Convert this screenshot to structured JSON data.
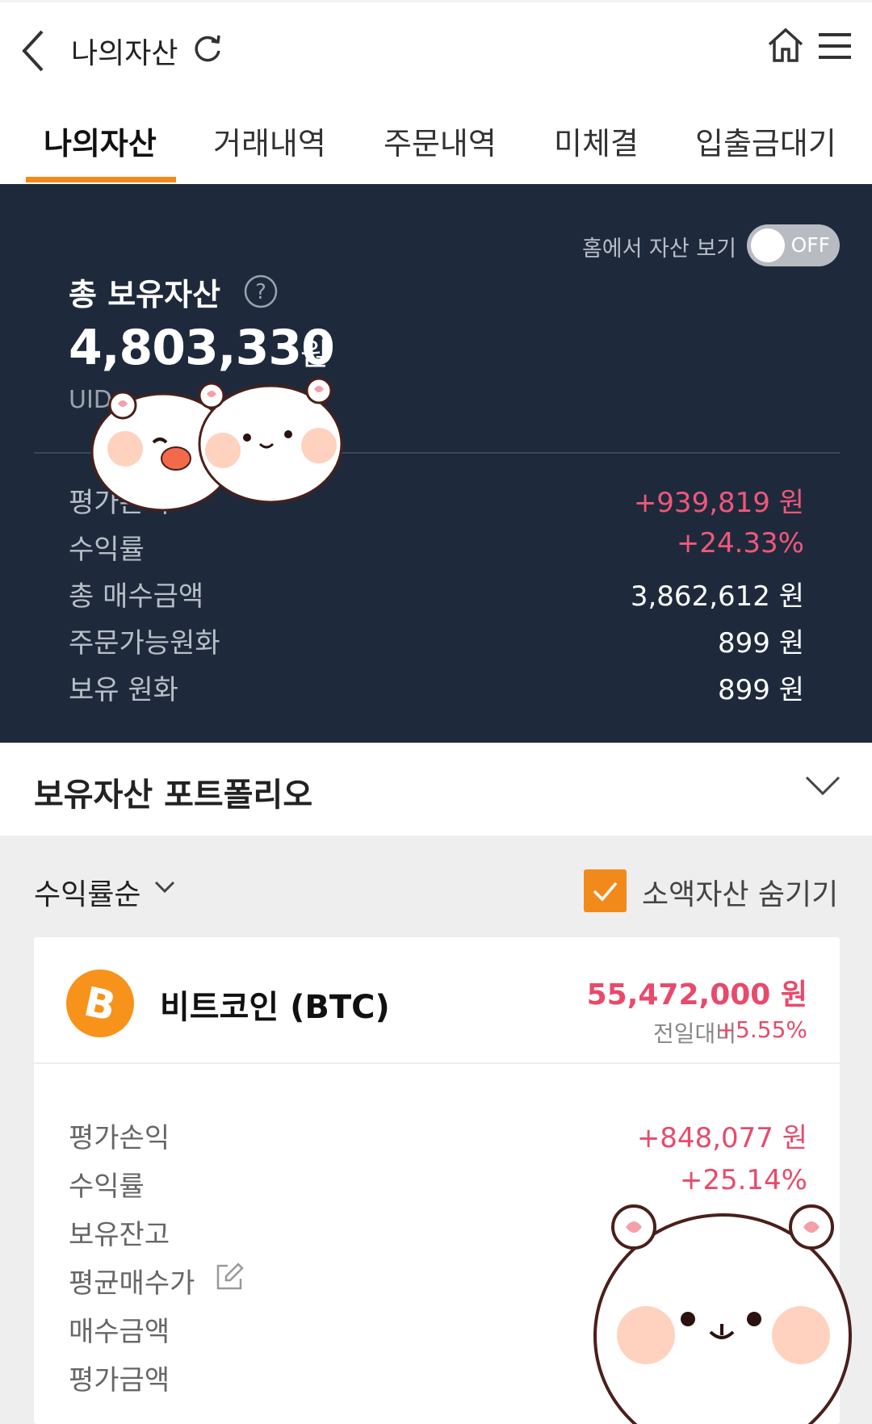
{
  "header": {
    "title": "나의자산"
  },
  "tabs": [
    "나의자산",
    "거래내역",
    "주문내역",
    "미체결",
    "입출금대기"
  ],
  "summary": {
    "home_toggle_label": "홈에서 자산 보기",
    "toggle_state": "OFF",
    "total_label": "총 보유자산",
    "total_value": "4,803,330",
    "total_unit": "원",
    "uid_label": "UID",
    "rows": [
      {
        "label": "평가손익",
        "value": "+939,819 원"
      },
      {
        "label": "수익률",
        "value": "+24.33%"
      },
      {
        "label": "총 매수금액",
        "value": "3,862,612 원"
      },
      {
        "label": "주문가능원화",
        "value": "899 원"
      },
      {
        "label": "보유 원화",
        "value": "899 원"
      }
    ]
  },
  "portfolio": {
    "title": "보유자산 포트폴리오",
    "sort_label": "수익률순",
    "hide_small_label": "소액자산 숨기기",
    "hide_small_checked": true
  },
  "coin": {
    "name": "비트코인 (BTC)",
    "price": "55,472,000 원",
    "change_label": "전일대비",
    "change": "+5.55%",
    "rows": [
      {
        "label": "평가손익",
        "value": "+848,077 원"
      },
      {
        "label": "수익률",
        "value": "+25.14%"
      },
      {
        "label": "보유잔고",
        "value": ""
      },
      {
        "label": "평균매수가",
        "value": ""
      },
      {
        "label": "매수금액",
        "value": ""
      },
      {
        "label": "평가금액",
        "value": ""
      }
    ]
  },
  "colors": {
    "accent": "#f28a1b",
    "summary_bg": "#1e2a3c",
    "positive": "#e84a6b",
    "btc": "#f7931a"
  }
}
